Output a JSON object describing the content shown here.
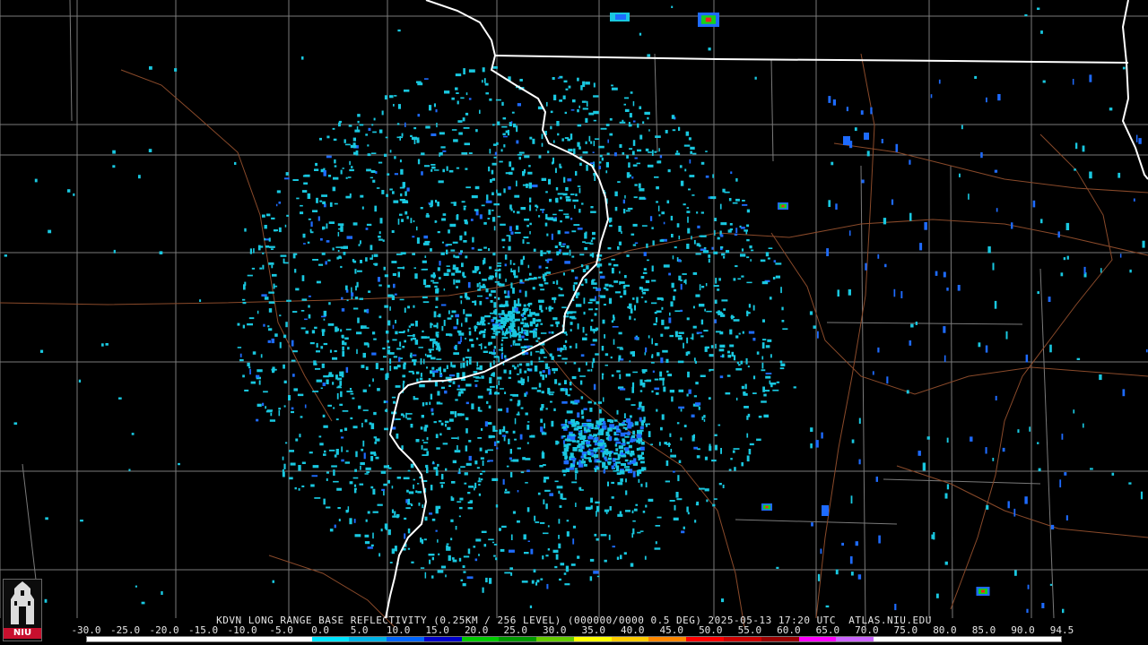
{
  "caption": "KDVN LONG RANGE BASE REFLECTIVITY (0.25KM / 256 LEVEL) (000000/0000 0.5 DEG) 2025-05-13 17:20 UTC  ATLAS.NIU.EDU",
  "scale_labels": [
    "-30.0",
    "-25.0",
    "-20.0",
    "-15.0",
    "-10.0",
    "-5.0",
    "0.0",
    "5.0",
    "10.0",
    "15.0",
    "20.0",
    "25.0",
    "30.0",
    "35.0",
    "40.0",
    "45.0",
    "50.0",
    "55.0",
    "60.0",
    "65.0",
    "70.0",
    "75.0",
    "80.0",
    "85.0",
    "90.0",
    "94.5"
  ],
  "scale_colors": [
    "#ffffff",
    "#ffffff",
    "#ffffff",
    "#ffffff",
    "#ffffff",
    "#ffffff",
    "#00e5ff",
    "#00b4e6",
    "#0066ff",
    "#0000cc",
    "#00cc00",
    "#009900",
    "#66cc00",
    "#ffff00",
    "#ffcc00",
    "#ff8800",
    "#ff0000",
    "#cc0000",
    "#990000",
    "#ff00ff",
    "#cc66ff",
    "#ffffff",
    "#ffffff",
    "#ffffff",
    "#ffffff",
    "#ffffff"
  ],
  "logo_text": "NIU",
  "colors": {
    "background": "#000000",
    "county_lines": "#7a7a7a",
    "state_lines": "#ffffff",
    "roads": "#8a4a2a",
    "echo_light": "#19c8e0",
    "echo_medium": "#1e6bff",
    "echo_strong": "#19d219",
    "echo_intense": "#ff2020"
  },
  "icons": {
    "logo": "niu-tower-logo"
  }
}
